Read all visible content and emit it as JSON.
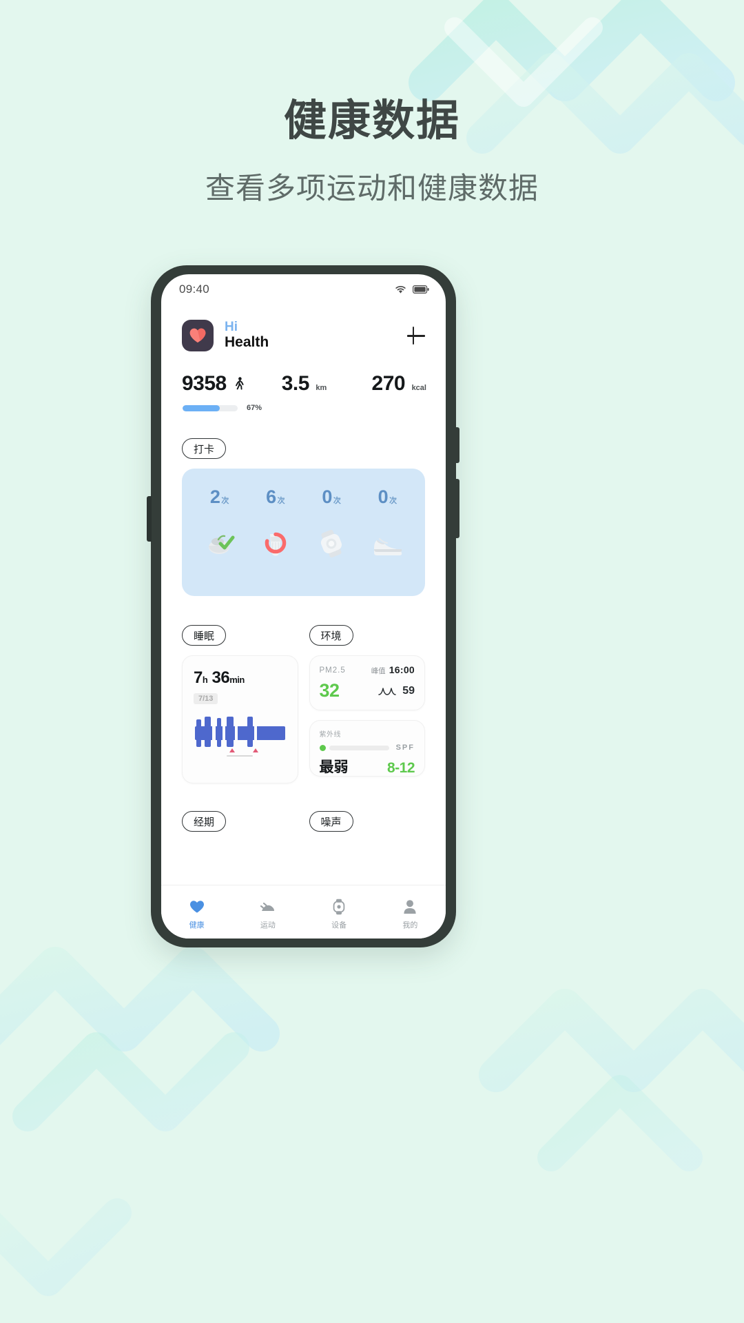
{
  "page": {
    "background_color": "#e3f7ee",
    "headline": "健康数据",
    "subhead": "查看多项运动和健康数据"
  },
  "status_bar": {
    "time": "09:40",
    "wifi_icon": "wifi-icon",
    "battery_icon": "battery-icon"
  },
  "app_header": {
    "logo_icon": "heart-logo-icon",
    "greeting": "Hi",
    "app_name": "Health",
    "add_label": "+",
    "greeting_color": "#7bb3ef"
  },
  "stats": {
    "steps": {
      "value": "9358",
      "unit": "",
      "icon": "walking-icon"
    },
    "distance": {
      "value": "3.5",
      "unit": "km"
    },
    "calories": {
      "value": "270",
      "unit": "kcal"
    },
    "progress": {
      "percent_label": "67%",
      "percent": 67,
      "color": "#6cb0f5"
    }
  },
  "checkin": {
    "pill_label": "打卡",
    "card_color": "#d3e7f8",
    "items": [
      {
        "count": "2",
        "unit": "次",
        "icon": "meal-check-icon"
      },
      {
        "count": "6",
        "unit": "次",
        "icon": "water-ring-icon"
      },
      {
        "count": "0",
        "unit": "次",
        "icon": "watch-icon"
      },
      {
        "count": "0",
        "unit": "次",
        "icon": "shoe-icon"
      }
    ]
  },
  "sleep": {
    "pill_label": "睡眠",
    "hours": "7",
    "hours_unit": "h",
    "minutes": "36",
    "minutes_unit": "min",
    "date_badge": "7/13"
  },
  "environment": {
    "pill_label": "环境",
    "pm": {
      "label": "PM2.5",
      "value": "32",
      "peak_label": "峰值",
      "peak_time": "16:00",
      "noise_icon": "wave-icon",
      "noise_value": "59"
    },
    "uv": {
      "label": "紫外线",
      "level": "最弱",
      "spf_label": "SPF",
      "spf_value": "8-12",
      "accent_color": "#5ec94d"
    }
  },
  "bottom_sections": {
    "period_pill": "经期",
    "noise_pill": "噪声"
  },
  "tabbar": {
    "tabs": [
      {
        "label": "健康",
        "icon": "heart-icon",
        "active": true
      },
      {
        "label": "运动",
        "icon": "running-icon",
        "active": false
      },
      {
        "label": "设备",
        "icon": "watch-device-icon",
        "active": false
      },
      {
        "label": "我的",
        "icon": "person-icon",
        "active": false
      }
    ],
    "active_color": "#4a90e2"
  }
}
